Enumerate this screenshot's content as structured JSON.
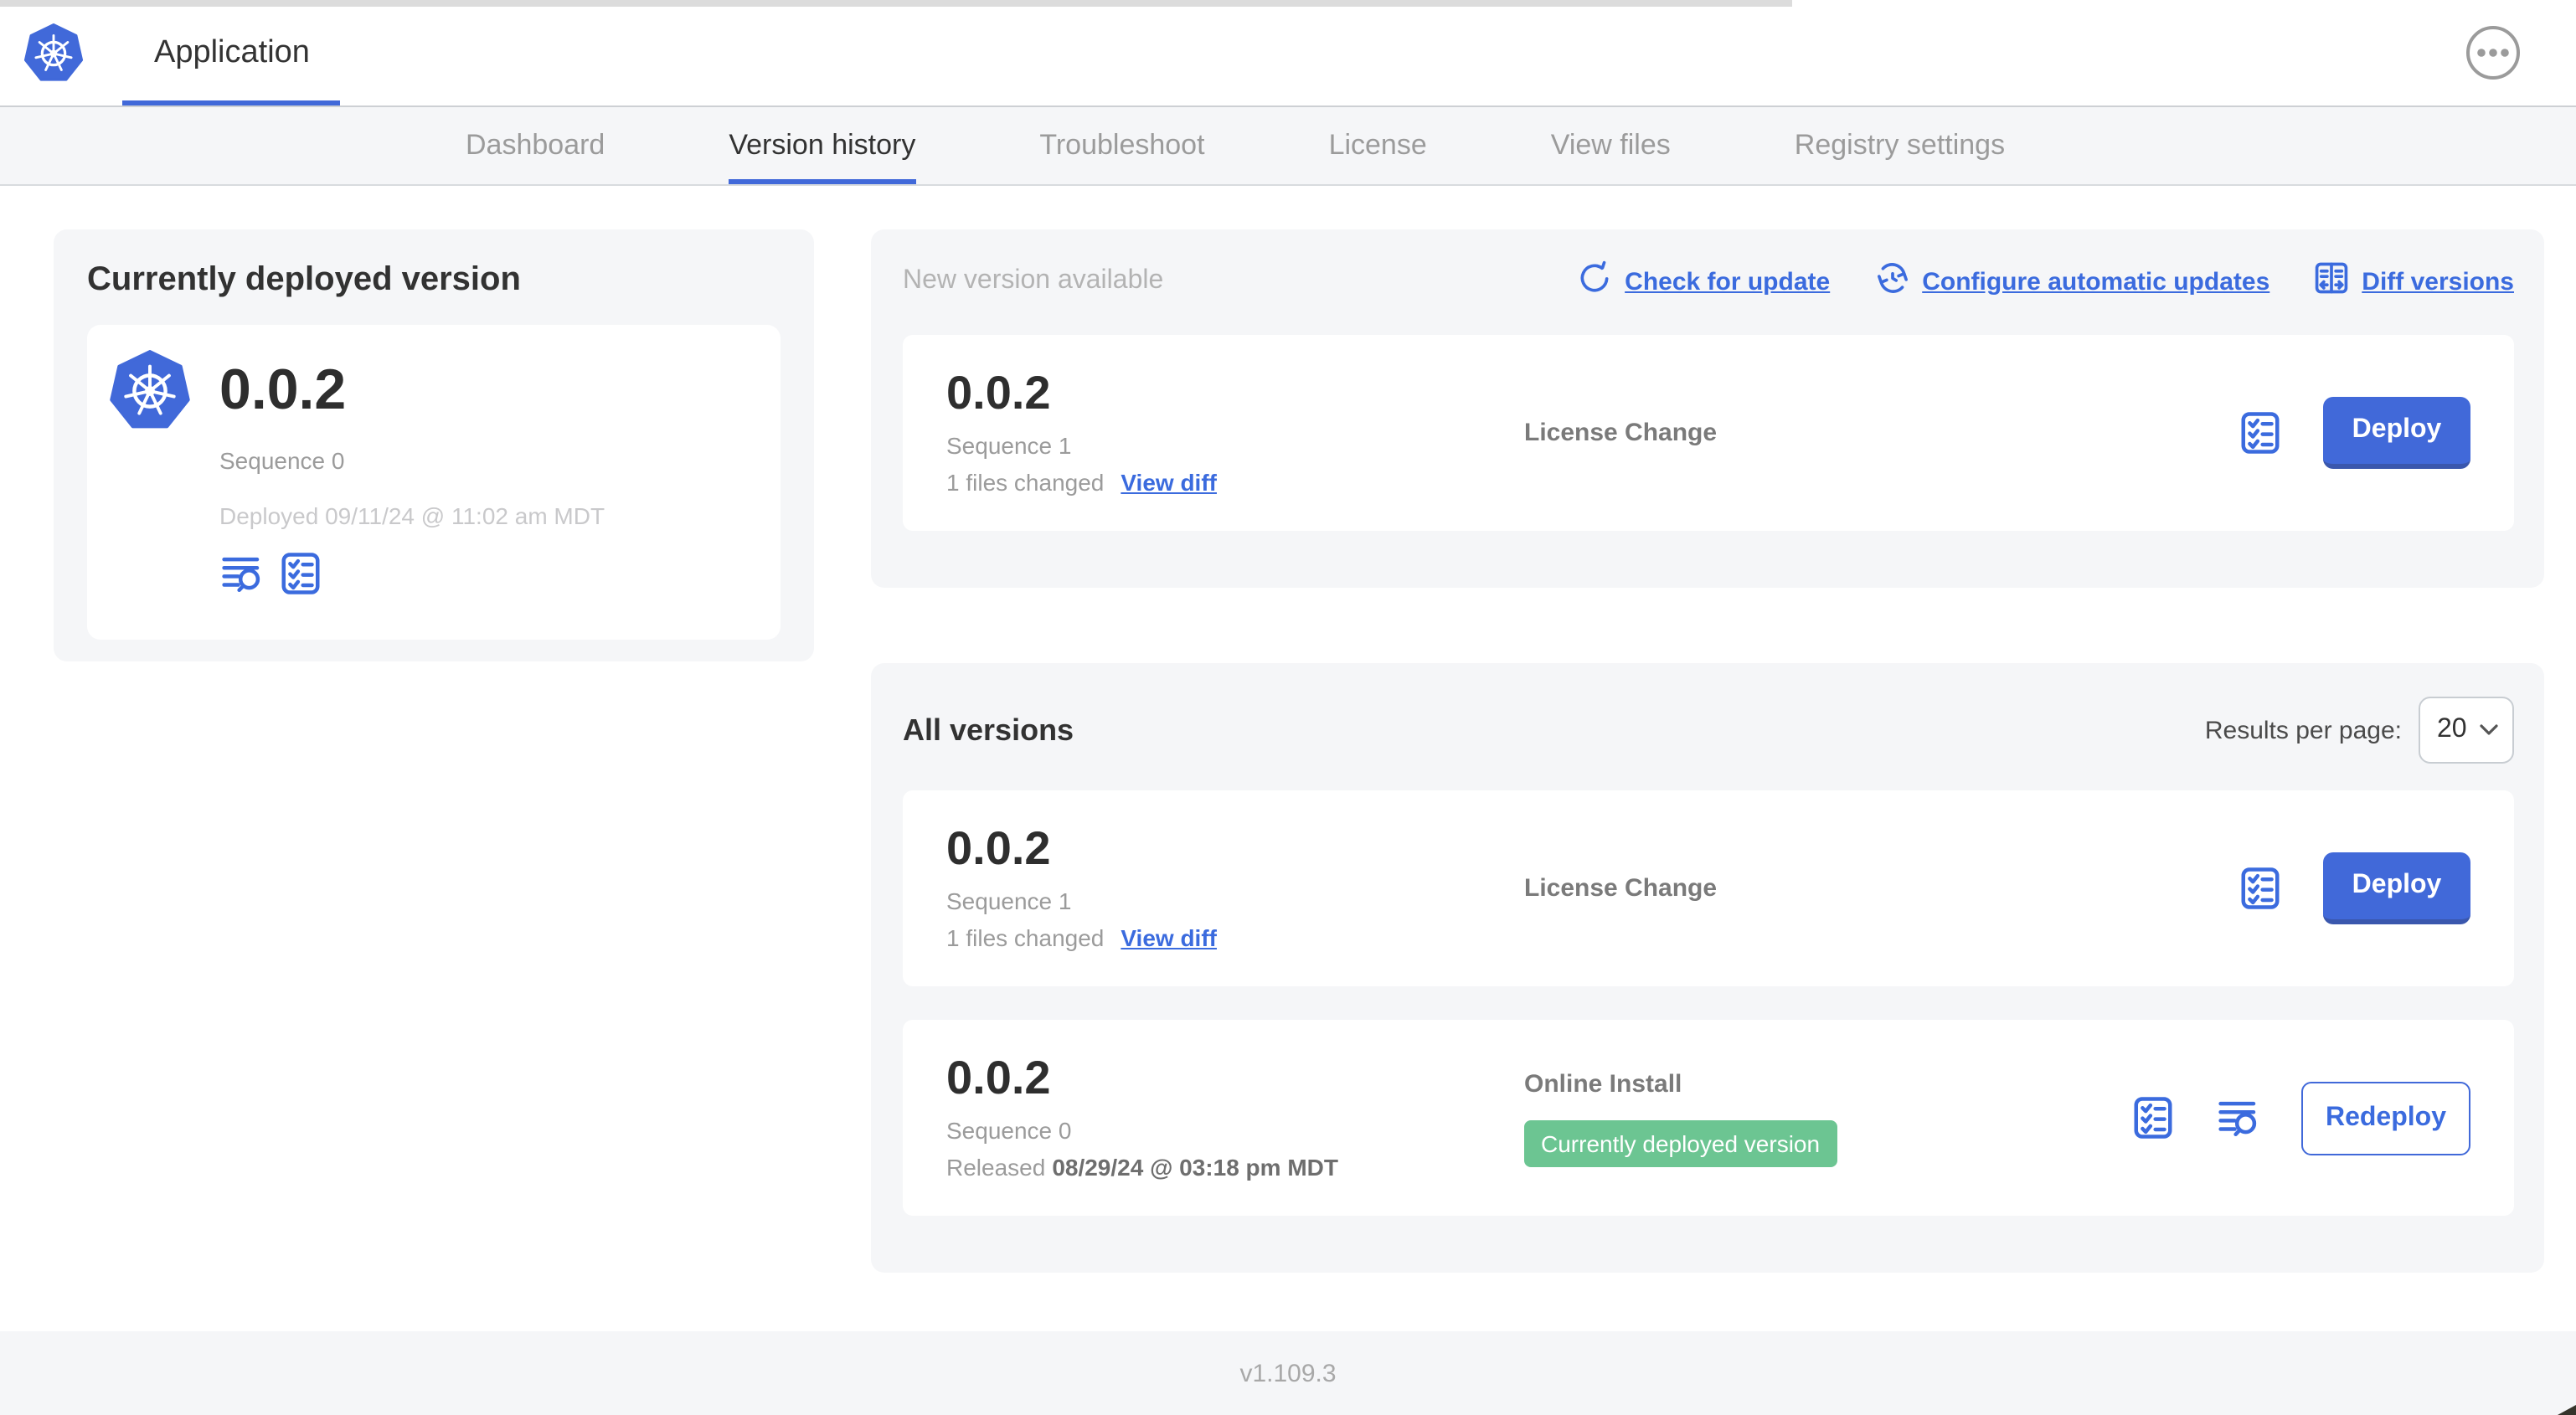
{
  "header": {
    "app_title": "Application"
  },
  "nav": {
    "tabs": [
      {
        "label": "Dashboard",
        "active": false
      },
      {
        "label": "Version history",
        "active": true
      },
      {
        "label": "Troubleshoot",
        "active": false
      },
      {
        "label": "License",
        "active": false
      },
      {
        "label": "View files",
        "active": false
      },
      {
        "label": "Registry settings",
        "active": false
      }
    ]
  },
  "deployed": {
    "title": "Currently deployed version",
    "version": "0.0.2",
    "sequence": "Sequence 0",
    "deployed_at": "Deployed 09/11/24 @ 11:02 am MDT"
  },
  "new_version": {
    "title": "New version available",
    "actions": {
      "check": "Check for update",
      "configure": "Configure automatic updates",
      "diff": "Diff versions"
    },
    "row": {
      "version": "0.0.2",
      "sequence": "Sequence 1",
      "files_changed": "1 files changed",
      "view_diff": "View diff",
      "source": "License Change",
      "action": "Deploy"
    }
  },
  "all_versions": {
    "title": "All versions",
    "results_per_page_label": "Results per page:",
    "results_per_page_value": "20",
    "rows": [
      {
        "version": "0.0.2",
        "sequence": "Sequence 1",
        "files_changed": "1 files changed",
        "view_diff": "View diff",
        "source": "License Change",
        "action": "Deploy"
      },
      {
        "version": "0.0.2",
        "sequence": "Sequence 0",
        "released_label": "Released",
        "released_date": "08/29/24 @ 03:18 pm MDT",
        "source": "Online Install",
        "badge": "Currently deployed version",
        "action": "Redeploy"
      }
    ]
  },
  "footer": {
    "version": "v1.109.3"
  },
  "icons": {
    "logo": "kubernetes-wheel",
    "menu": "ellipsis-circle",
    "check_update": "refresh-arrow",
    "configure": "clock-sync-arrows",
    "diff": "split-columns-arrows",
    "preflight": "checklist-clipboard",
    "logs": "lines-magnifier",
    "select": "chevron-down"
  },
  "colors": {
    "accent_blue": "#4169d9",
    "link_blue": "#3b6bde",
    "badge_green": "#6cc592",
    "section_bg": "#f5f6f8",
    "text_dark": "#323232",
    "text_gray": "#9b9b9b",
    "text_light_gray": "#c9c9cb"
  }
}
